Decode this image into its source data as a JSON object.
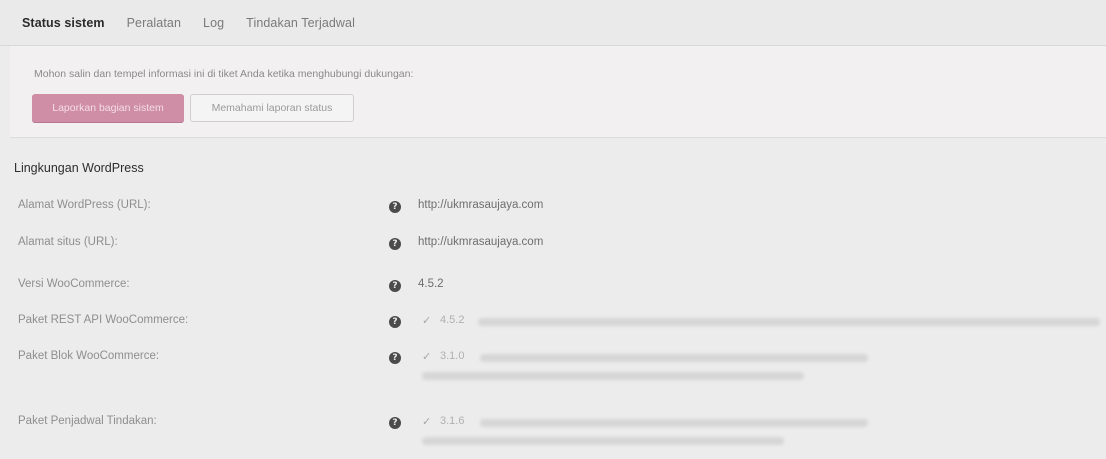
{
  "tabs": [
    {
      "label": "Status sistem",
      "active": true
    },
    {
      "label": "Peralatan",
      "active": false
    },
    {
      "label": "Log",
      "active": false
    },
    {
      "label": "Tindakan Terjadwal",
      "active": false
    }
  ],
  "notice": {
    "text": "Mohon salin dan tempel informasi ini di tiket Anda ketika menghubungi dukungan:",
    "primary_button": "Laporkan bagian sistem",
    "secondary_button": "Memahami laporan status"
  },
  "section": {
    "title": "Lingkungan WordPress"
  },
  "rows": [
    {
      "label": "Alamat WordPress (URL):",
      "value": "http://ukmrasaujaya.com"
    },
    {
      "label": "Alamat situs (URL):",
      "value": "http://ukmrasaujaya.com"
    },
    {
      "label": "Versi WooCommerce:",
      "value": "4.5.2"
    },
    {
      "label": "Paket REST API WooCommerce:",
      "check": "✓",
      "version": "4.5.2"
    },
    {
      "label": "Paket Blok WooCommerce:",
      "check": "✓",
      "version": "3.1.0"
    },
    {
      "label": "Paket Penjadwal Tindakan:",
      "check": "✓",
      "version": "3.1.6"
    }
  ],
  "colors": {
    "accent": "#cf8ea6",
    "background": "#ececec"
  },
  "icons": {
    "help": "question-circle-icon",
    "check": "checkmark-icon"
  }
}
